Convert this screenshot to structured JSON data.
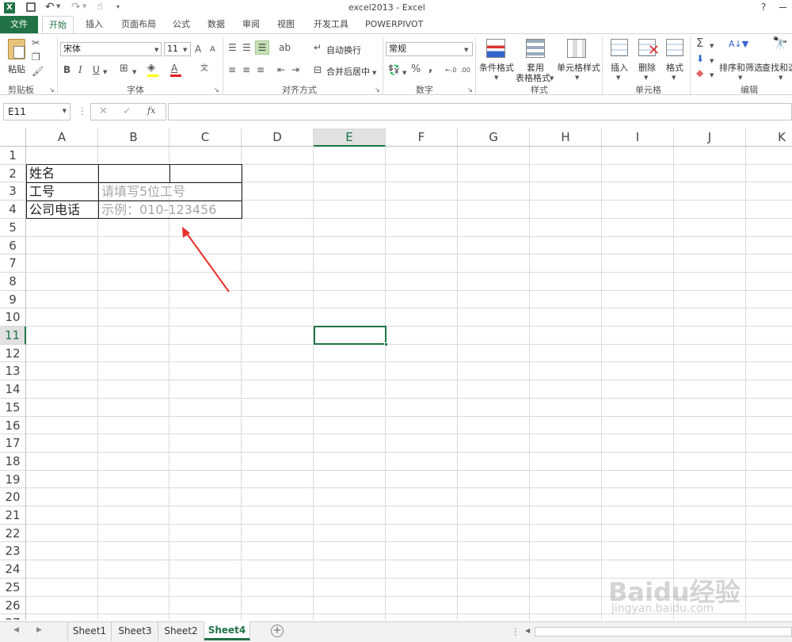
{
  "title": "excel2013 - Excel",
  "help": "?",
  "tabs": [
    "文件",
    "开始",
    "插入",
    "页面布局",
    "公式",
    "数据",
    "审阅",
    "视图",
    "开发工具",
    "POWERPIVOT"
  ],
  "ribbon": {
    "paste": "粘贴",
    "clipboard": "剪贴板",
    "font_name": "宋体",
    "font_size": "11",
    "bold": "B",
    "italic": "I",
    "underline": "U",
    "grow": "A",
    "shrink": "A",
    "font_group": "字体",
    "wrap": "自动换行",
    "merge": "合并后居中",
    "align_group": "对齐方式",
    "number_format": "常规",
    "percent": "%",
    "comma": ",",
    "number_group": "数字",
    "cond_format": "条件格式",
    "table_format_1": "套用",
    "table_format_2": "表格格式",
    "cell_style": "单元格样式",
    "style_group": "样式",
    "insert": "插入",
    "delete": "删除",
    "format": "格式",
    "cells_group": "单元格",
    "sum": "Σ",
    "sort": "排序和筛选",
    "find": "查找和选",
    "edit_group": "编辑"
  },
  "namebox": "E11",
  "fx": "fx",
  "columns": [
    "A",
    "B",
    "C",
    "D",
    "E",
    "F",
    "G",
    "H",
    "I",
    "J",
    "K"
  ],
  "rows": [
    "1",
    "2",
    "3",
    "4",
    "5",
    "6",
    "7",
    "8",
    "9",
    "10",
    "11",
    "12",
    "13",
    "14",
    "15",
    "16",
    "17",
    "18",
    "19",
    "20",
    "21",
    "22",
    "23",
    "24",
    "25",
    "26",
    "27"
  ],
  "cells": {
    "a2": "姓名",
    "a3": "工号",
    "a4": "公司电话",
    "b3": "请填写5位工号",
    "b4": "示例：010-123456"
  },
  "sheets": [
    "Sheet1",
    "Sheet3",
    "Sheet2",
    "Sheet4"
  ],
  "active_sheet": "Sheet4",
  "watermark": "Baidu经验",
  "watermark_url": "jingyan.baidu.com",
  "colors": {
    "excel_green": "#217346",
    "arrow": "#e8302a",
    "placeholder": "#a6a6a6"
  }
}
